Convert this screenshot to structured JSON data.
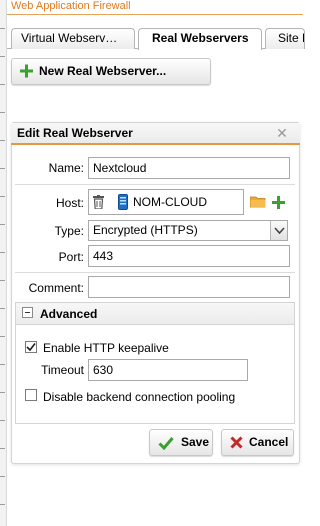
{
  "app": {
    "title": "Web Application Firewall"
  },
  "tabs": [
    {
      "label": "Virtual Webserv…",
      "active": false
    },
    {
      "label": "Real Webservers",
      "active": true
    },
    {
      "label": "Site P",
      "active": false
    }
  ],
  "toolbar": {
    "new_label": "New Real Webserver..."
  },
  "dialog": {
    "title": "Edit Real Webserver",
    "name": {
      "label": "Name:",
      "value": "Nextcloud"
    },
    "host": {
      "label": "Host:",
      "value": "NOM-CLOUD"
    },
    "type": {
      "label": "Type:",
      "value": "Encrypted (HTTPS)"
    },
    "port": {
      "label": "Port:",
      "value": "443"
    },
    "comment": {
      "label": "Comment:",
      "value": ""
    },
    "advanced": {
      "title": "Advanced",
      "keepalive": {
        "label": "Enable HTTP keepalive",
        "checked": true
      },
      "timeout": {
        "label": "Timeout",
        "value": "630"
      },
      "pooling": {
        "label": "Disable backend connection pooling",
        "checked": false
      }
    },
    "buttons": {
      "save": "Save",
      "cancel": "Cancel"
    }
  },
  "colors": {
    "accent": "#e8963f",
    "ok_green": "#3aa12f",
    "cancel_red": "#c62828",
    "server_blue": "#1e6fc4"
  },
  "icons": [
    "plus-icon",
    "close-icon",
    "trash-icon",
    "server-icon",
    "folder-icon",
    "checkmark-icon",
    "cancel-x-icon",
    "collapse-icon"
  ]
}
